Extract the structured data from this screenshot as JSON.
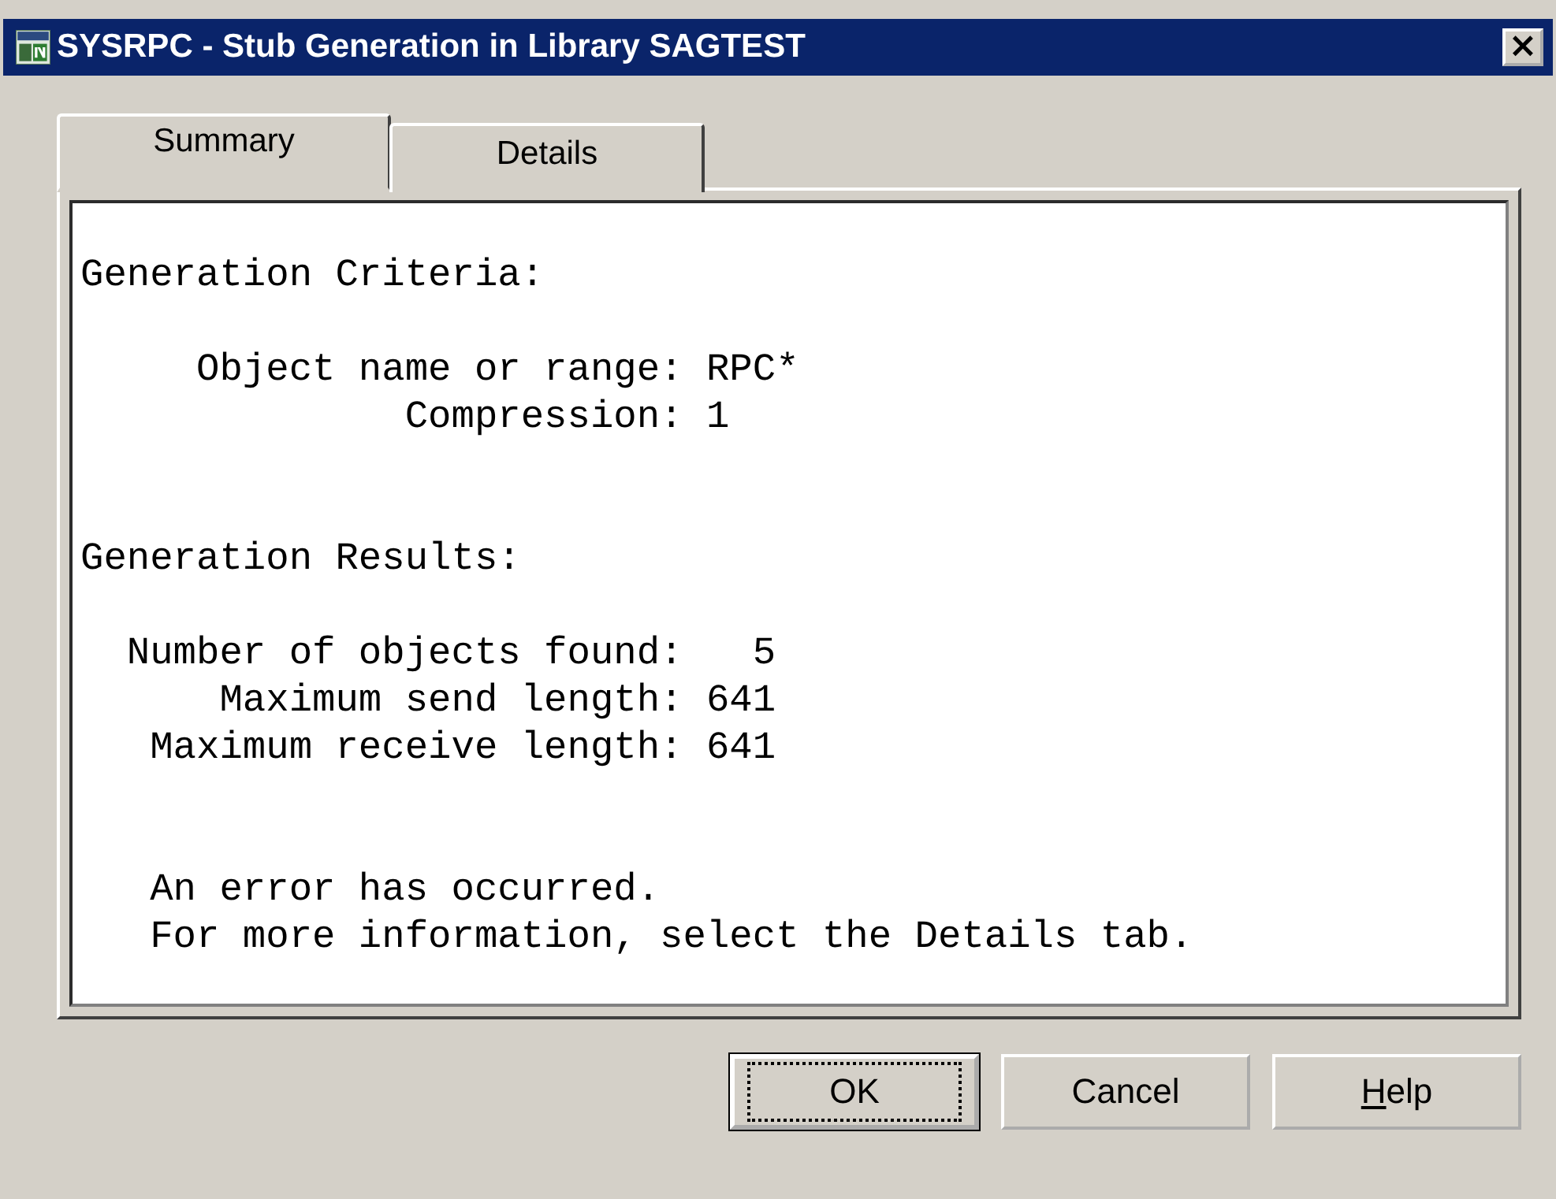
{
  "window": {
    "title": "SYSRPC - Stub Generation in Library SAGTEST",
    "close": "×"
  },
  "tabs": [
    {
      "label": "Summary",
      "selected": true
    },
    {
      "label": "Details",
      "selected": false
    }
  ],
  "summary_blocks": [
    {
      "heading": "Generation Criteria:",
      "lines": [
        "     Object name or range: RPC*",
        "              Compression: 1"
      ]
    },
    {
      "heading": "Generation Results:",
      "lines": [
        "  Number of objects found:   5",
        "      Maximum send length: 641",
        "   Maximum receive length: 641"
      ]
    },
    {
      "lines": [
        "   An error has occurred.",
        "   For more information, select the Details tab."
      ]
    }
  ],
  "buttons": [
    {
      "label": "OK",
      "default": true,
      "mnemonic_first": false
    },
    {
      "label": "Cancel",
      "default": false,
      "mnemonic_first": false
    },
    {
      "label": "Help",
      "default": false,
      "mnemonic_first": true
    }
  ]
}
